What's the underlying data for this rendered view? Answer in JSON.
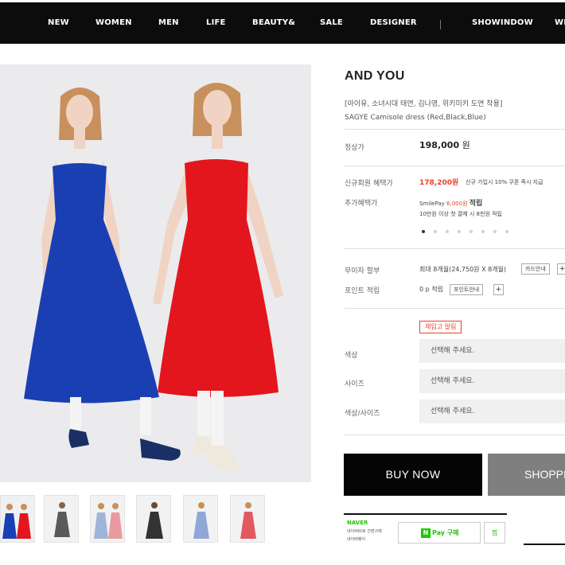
{
  "nav": {
    "items": [
      "NEW",
      "WOMEN",
      "MEN",
      "LIFE",
      "BEAUTY&",
      "SALE",
      "DESIGNER",
      "SHOWINDOW",
      "WI"
    ]
  },
  "product": {
    "brand": "AND YOU",
    "subtitle": "[아이유, 소녀시대 태연, 김나영, 위키미키 도연 착용]",
    "name": "SAGYE Camisole dress (Red,Black,Blue)",
    "price_label": "정상가",
    "price": "198,000",
    "price_unit": "원",
    "new_member_label": "신규회원 혜택가",
    "new_member_price": "178,200원",
    "new_member_note": "신규 가입시 10% 쿠폰 즉시 지급",
    "extra_label": "추가혜택가",
    "smilepay_text": "SmilePay",
    "smilepay_amount": "6,000원",
    "smilepay_suffix": "적립",
    "smilepay_note": "10만원 이상 첫 결제 시 8천원 적립",
    "installment_label": "무이자 할부",
    "installment_value": "최대 8개월(24,750원 X 8개월)",
    "installment_btn": "카드안내",
    "point_label": "포인트 적립",
    "point_value": "0 p 적립",
    "point_btn": "포인트안내",
    "plus": "+",
    "restock_btn": "재입고 알림",
    "color_label": "색상",
    "size_label": "사이즈",
    "colorsize_label": "색상/사이즈",
    "select_placeholder": "선택해 주세요.",
    "buy_now": "BUY NOW",
    "shopping_bag": "SHOPPING BAG"
  },
  "naver": {
    "logo": "NAVER",
    "line1": "네이버ID로 간편구매",
    "line2": "네이버페이",
    "npay_label": "Pay 구매",
    "wish": "찜"
  },
  "photo": {
    "colors": {
      "background": "#ebebed",
      "blue_dress": "#1a3fb3",
      "red_dress": "#e3161d",
      "hair": "#c8905c",
      "skin": "#f1d3c3"
    }
  },
  "thumbnails": [
    {
      "dresses": [
        "#1a3fb3",
        "#e3161d"
      ]
    },
    {
      "dresses": [
        "#5a5a5a"
      ]
    },
    {
      "dresses": [
        "#9fb4d8",
        "#e99aa0"
      ]
    },
    {
      "dresses": [
        "#333333"
      ]
    },
    {
      "dresses": [
        "#8fa6d6"
      ]
    },
    {
      "dresses": [
        "#e25a60"
      ]
    }
  ],
  "carousel": {
    "count": 8,
    "active": 0
  }
}
